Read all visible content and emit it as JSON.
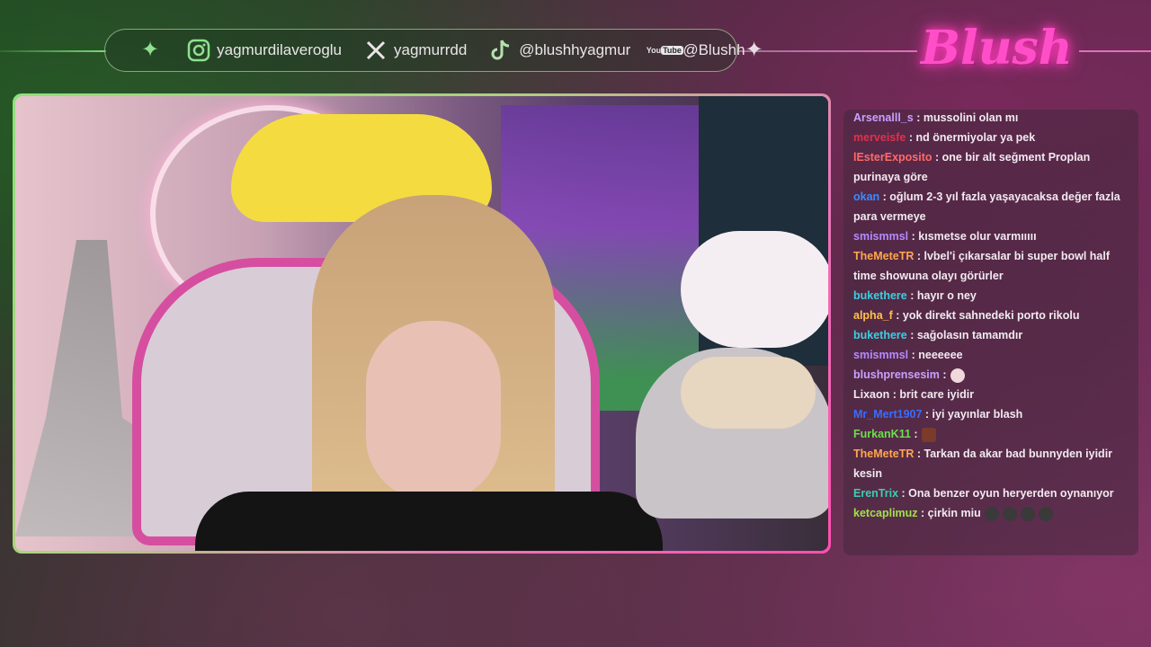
{
  "social": {
    "instagram": "yagmurdilaveroglu",
    "x": "yagmurrdd",
    "tiktok": "@blushhyagmur",
    "youtube_icon_top": "You",
    "youtube_icon_bottom": "Tube",
    "youtube": "@Blushh"
  },
  "logo_text": "Blush",
  "colors": {
    "accent_green": "#8ee07a",
    "accent_pink": "#ff4fb0"
  },
  "chat": [
    {
      "user": "Arsenalll_s",
      "color": "#c9a0ff",
      "text": ": mussolini olan mı"
    },
    {
      "user": "merveisfe",
      "color": "#e0304a",
      "text": ": nd önermiyolar ya pek"
    },
    {
      "user": "lEsterExposito",
      "color": "#ff6a6a",
      "text": ": one bir alt seğment Proplan purinaya göre"
    },
    {
      "user": "okan",
      "color": "#3a8cff",
      "text": ": oğlum 2-3 yıl fazla yaşayacaksa değer fazla para vermeye"
    },
    {
      "user": "smismmsl",
      "color": "#b48aff",
      "text": ": kısmetse olur varmııııı"
    },
    {
      "user": "TheMeteTR",
      "color": "#ffa64d",
      "text": ": lvbel'i çıkarsalar bi super bowl half time showuna olayı görürler"
    },
    {
      "user": "bukethere",
      "color": "#3ad0e0",
      "text": ": hayır o ney"
    },
    {
      "user": "alpha_f",
      "color": "#ffc14d",
      "text": ": yok direkt sahnedeki porto rikolu"
    },
    {
      "user": "bukethere",
      "color": "#3ad0e0",
      "text": ": sağolasın tamamdır"
    },
    {
      "user": "smismmsl",
      "color": "#b48aff",
      "text": ": neeeeee"
    },
    {
      "user": "blushprensesim",
      "color": "#c9a0ff",
      "text": ":",
      "emotes": [
        "baby"
      ]
    },
    {
      "user": "Lixaon",
      "color": "#f1eaf0",
      "text": ": brit care iyidir"
    },
    {
      "user": "Mr_Mert1907",
      "color": "#3a6cff",
      "text": ": iyi yayınlar blash"
    },
    {
      "user": "FurkanK11",
      "color": "#6ae04a",
      "text": ":",
      "emotes": [
        "brown"
      ]
    },
    {
      "user": "TheMeteTR",
      "color": "#ffa64d",
      "text": ": Tarkan da akar bad bunnyden iyidir kesin"
    },
    {
      "user": "ErenTrix",
      "color": "#3ad0b0",
      "text": ": Ona benzer oyun heryerden oynanıyor"
    },
    {
      "user": "ketcaplimuz",
      "color": "#a0e04a",
      "text": ": çirkin miu",
      "emotes": [
        "cat",
        "cat",
        "cat",
        "cat"
      ]
    }
  ]
}
